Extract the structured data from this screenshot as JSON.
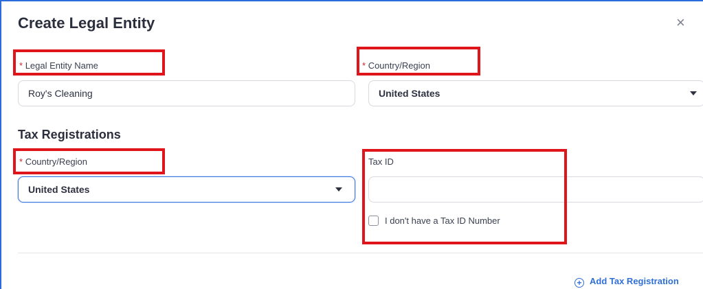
{
  "dialog": {
    "title": "Create Legal Entity",
    "close_icon": "×"
  },
  "entity": {
    "name_label": "Legal Entity Name",
    "name_value": "Roy's Cleaning",
    "country_label": "Country/Region",
    "country_value": "United States"
  },
  "tax": {
    "section_title": "Tax Registrations",
    "country_label": "Country/Region",
    "country_value": "United States",
    "tax_id_label": "Tax ID",
    "tax_id_value": "",
    "no_tax_id_label": "I don't have a Tax ID Number",
    "no_tax_id_checked": false,
    "add_label": "Add Tax Registration",
    "add_icon": "+"
  },
  "required_marker": "*",
  "colors": {
    "accent": "#2f6fd6",
    "required": "#d0232a",
    "highlight": "#e0151b"
  }
}
